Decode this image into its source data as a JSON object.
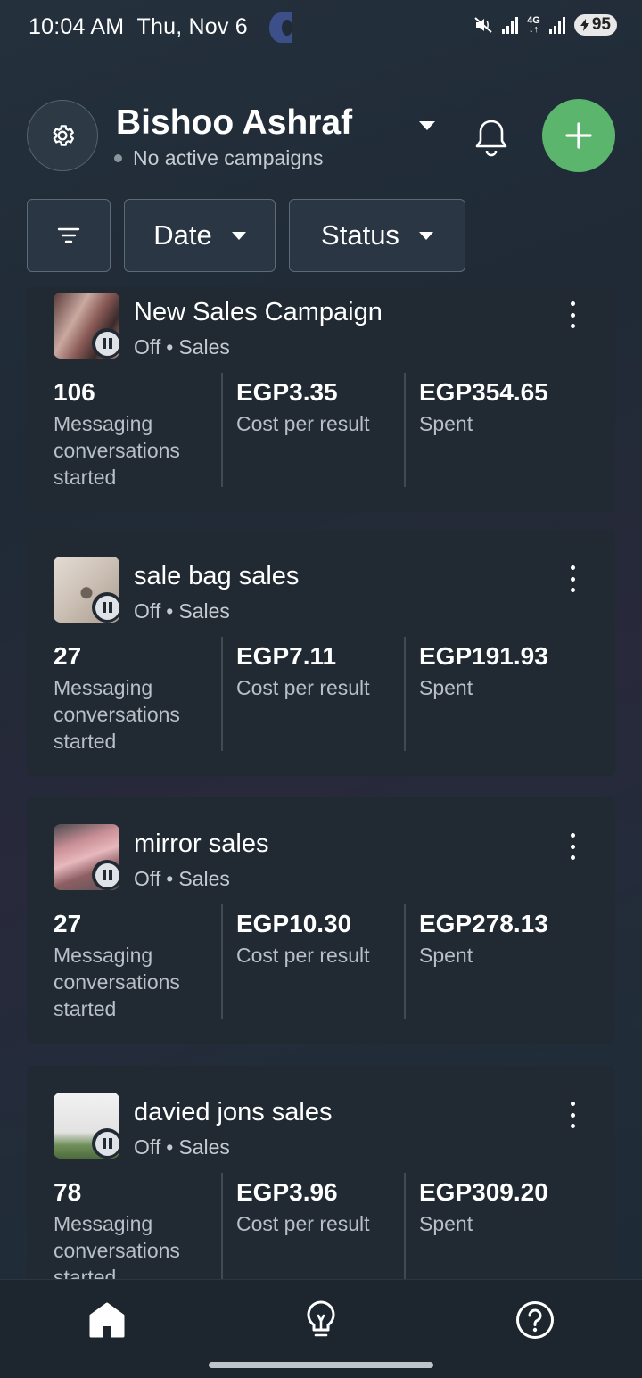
{
  "status_bar": {
    "time": "10:04 AM",
    "date": "Thu, Nov 6",
    "network": "4G",
    "battery": "95",
    "icons": [
      "moon-icon",
      "mute-icon",
      "signal-icon",
      "signal-icon",
      "battery-icon"
    ]
  },
  "header": {
    "account_name": "Bishoo Ashraf",
    "account_status": "No active campaigns",
    "icons": [
      "gear-icon",
      "chevron-down-icon",
      "bell-icon",
      "plus-icon"
    ],
    "accent_color": "#5bb56d"
  },
  "filters": {
    "items": [
      {
        "label": "",
        "icon": "filter-icon"
      },
      {
        "label": "Date",
        "icon": "chevron-down-icon"
      },
      {
        "label": "Status",
        "icon": "chevron-down-icon"
      }
    ]
  },
  "campaigns": [
    {
      "name": "New Sales Campaign",
      "state": "Off",
      "objective": "Sales",
      "results": "106",
      "results_label": "Messaging conversations started",
      "cost_per_result": "EGP3.35",
      "cost_label": "Cost per result",
      "spent": "EGP354.65",
      "spent_label": "Spent"
    },
    {
      "name": "sale bag sales",
      "state": "Off",
      "objective": "Sales",
      "results": "27",
      "results_label": "Messaging conversations started",
      "cost_per_result": "EGP7.11",
      "cost_label": "Cost per result",
      "spent": "EGP191.93",
      "spent_label": "Spent"
    },
    {
      "name": "mirror sales",
      "state": "Off",
      "objective": "Sales",
      "results": "27",
      "results_label": "Messaging conversations started",
      "cost_per_result": "EGP10.30",
      "cost_label": "Cost per result",
      "spent": "EGP278.13",
      "spent_label": "Spent"
    },
    {
      "name": "davied jons sales",
      "state": "Off",
      "objective": "Sales",
      "results": "78",
      "results_label": "Messaging conversations started",
      "cost_per_result": "EGP3.96",
      "cost_label": "Cost per result",
      "spent": "EGP309.20",
      "spent_label": "Spent"
    }
  ],
  "bottom_nav": {
    "items": [
      {
        "icon": "home-icon"
      },
      {
        "icon": "lightbulb-icon"
      },
      {
        "icon": "help-icon"
      }
    ]
  }
}
